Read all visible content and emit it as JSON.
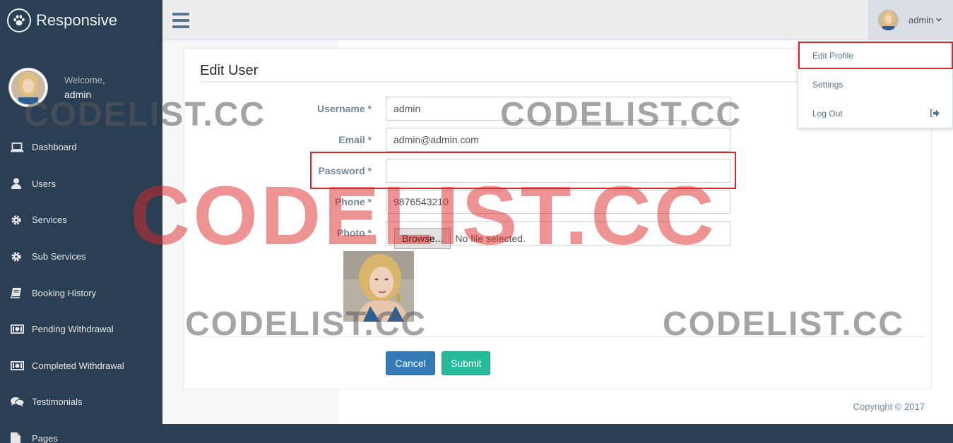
{
  "brand": {
    "name": "Responsive",
    "logo_icon": "paw-icon"
  },
  "profile": {
    "welcome": "Welcome,",
    "username": "admin"
  },
  "sidebar": {
    "items": [
      {
        "label": "Dashboard",
        "icon": "laptop-icon"
      },
      {
        "label": "Users",
        "icon": "user-icon"
      },
      {
        "label": "Services",
        "icon": "gear-icon"
      },
      {
        "label": "Sub Services",
        "icon": "gear-icon"
      },
      {
        "label": "Booking History",
        "icon": "book-icon"
      },
      {
        "label": "Pending Withdrawal",
        "icon": "money-icon"
      },
      {
        "label": "Completed Withdrawal",
        "icon": "money-icon"
      },
      {
        "label": "Testimonials",
        "icon": "comments-icon"
      },
      {
        "label": "Pages",
        "icon": "file-icon"
      }
    ]
  },
  "topnav": {
    "username": "admin",
    "caret": "chevron-down-icon"
  },
  "dropdown": {
    "items": [
      {
        "label": "Edit Profile"
      },
      {
        "label": "Settings"
      },
      {
        "label": "Log Out",
        "icon": "sign-out-icon"
      }
    ]
  },
  "form": {
    "title": "Edit User",
    "username": {
      "label": "Username *",
      "value": "admin"
    },
    "email": {
      "label": "Email *",
      "value": "admin@admin.com"
    },
    "password": {
      "label": "Password *",
      "value": ""
    },
    "phone": {
      "label": "Phone *",
      "value": "9876543210"
    },
    "photo": {
      "label": "Photo *",
      "browse_label": "Browse...",
      "status": "No file selected."
    },
    "cancel_label": "Cancel",
    "submit_label": "Submit"
  },
  "footer": {
    "copyright": "Copyright © 2017"
  },
  "watermark": {
    "text": "CODELIST.CC"
  },
  "colors": {
    "sidebar_bg": "#2a3f54",
    "topnav_bg": "#ededed",
    "cancel_btn": "#337ab7",
    "submit_btn": "#26b99a",
    "highlight": "#d9262e"
  }
}
